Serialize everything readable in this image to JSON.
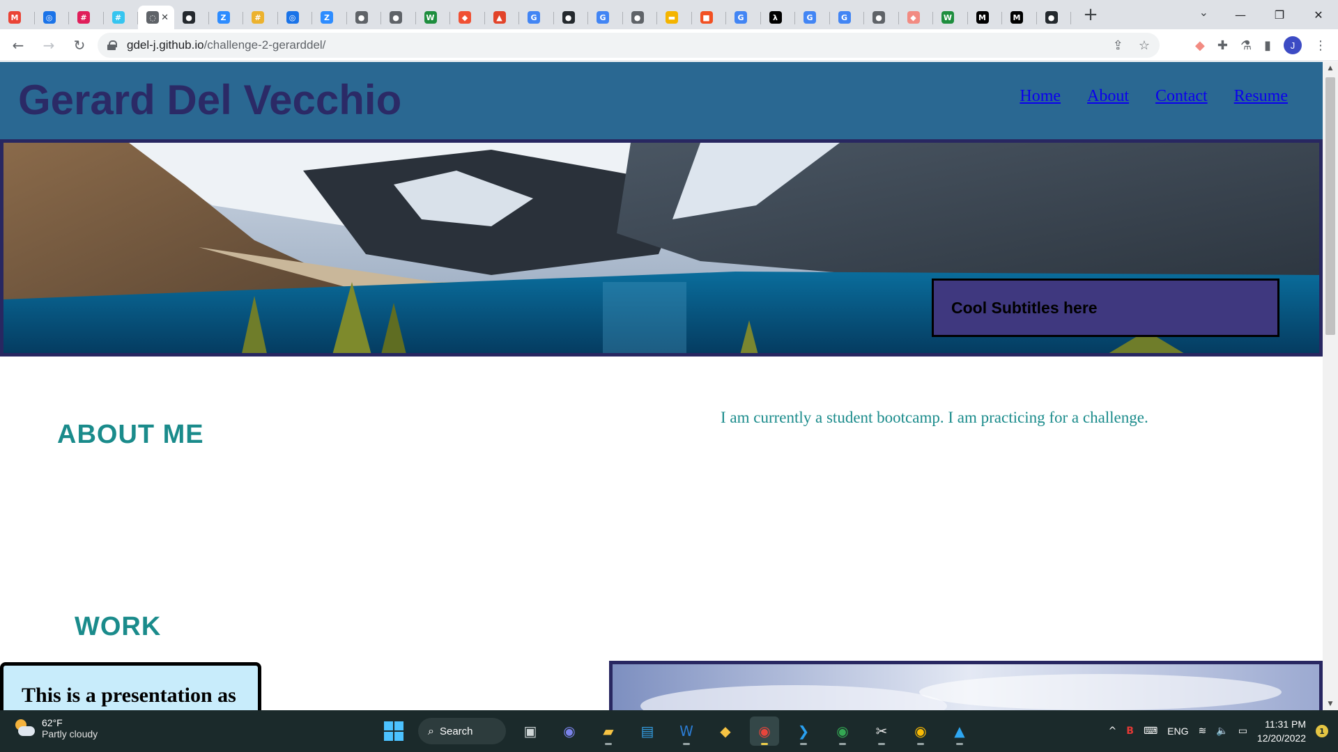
{
  "browser": {
    "tabs": [
      {
        "icon": "gmail-icon",
        "glyph": "M",
        "color": "#ea4335"
      },
      {
        "icon": "chrome-circle-icon",
        "glyph": "◎",
        "color": "#1a73e8"
      },
      {
        "icon": "slack-icon",
        "glyph": "#",
        "color": "#e01e5a"
      },
      {
        "icon": "slack-icon",
        "glyph": "#",
        "color": "#36c5f0"
      },
      {
        "icon": "loading-icon",
        "glyph": "◌",
        "color": "#5f6368",
        "active": true
      },
      {
        "icon": "github-icon",
        "glyph": "●",
        "color": "#24292e"
      },
      {
        "icon": "zoom-icon",
        "glyph": "Z",
        "color": "#2d8cff"
      },
      {
        "icon": "slack-icon",
        "glyph": "#",
        "color": "#ecb22e"
      },
      {
        "icon": "chrome-circle-icon",
        "glyph": "◎",
        "color": "#1a73e8"
      },
      {
        "icon": "zoom-icon",
        "glyph": "Z",
        "color": "#2d8cff"
      },
      {
        "icon": "globe-icon",
        "glyph": "●",
        "color": "#5f6368"
      },
      {
        "icon": "globe-icon",
        "glyph": "●",
        "color": "#5f6368"
      },
      {
        "icon": "w-icon",
        "glyph": "W",
        "color": "#1e8e3e"
      },
      {
        "icon": "git-icon",
        "glyph": "◆",
        "color": "#f05033"
      },
      {
        "icon": "gitlab-icon",
        "glyph": "▲",
        "color": "#e24329"
      },
      {
        "icon": "google-icon",
        "glyph": "G",
        "color": "#4285f4"
      },
      {
        "icon": "github-icon",
        "glyph": "●",
        "color": "#24292e"
      },
      {
        "icon": "google-icon",
        "glyph": "G",
        "color": "#4285f4"
      },
      {
        "icon": "globe-icon",
        "glyph": "●",
        "color": "#5f6368"
      },
      {
        "icon": "slides-icon",
        "glyph": "▬",
        "color": "#f4b400"
      },
      {
        "icon": "microsoft-icon",
        "glyph": "■",
        "color": "#f25022"
      },
      {
        "icon": "google-icon",
        "glyph": "G",
        "color": "#4285f4"
      },
      {
        "icon": "code-icon",
        "glyph": "λ",
        "color": "#000000"
      },
      {
        "icon": "google-icon",
        "glyph": "G",
        "color": "#4285f4"
      },
      {
        "icon": "google-icon",
        "glyph": "G",
        "color": "#4285f4"
      },
      {
        "icon": "globe-icon",
        "glyph": "●",
        "color": "#5f6368"
      },
      {
        "icon": "extension-icon",
        "glyph": "◆",
        "color": "#f28b82"
      },
      {
        "icon": "w-icon",
        "glyph": "W",
        "color": "#1e8e3e"
      },
      {
        "icon": "m-icon",
        "glyph": "M",
        "color": "#000000"
      },
      {
        "icon": "m-icon",
        "glyph": "M",
        "color": "#000000"
      },
      {
        "icon": "github-icon",
        "glyph": "●",
        "color": "#24292e"
      }
    ],
    "url_host": "gdel-j.github.io",
    "url_path": "/challenge-2-gerarddel/",
    "profile_initial": "J"
  },
  "site": {
    "title": "Gerard Del Vecchio",
    "nav": [
      "Home",
      "About",
      "Contact",
      "Resume"
    ],
    "hero_subtitle": "Cool Subtitles here",
    "about_heading": "ABOUT ME",
    "about_text": "I am currently a student bootcamp. I am practicing for a challenge.",
    "work_heading": "WORK",
    "work_card_text": "This is a presentation as"
  },
  "taskbar": {
    "weather_temp": "62°F",
    "weather_desc": "Partly cloudy",
    "search_label": "Search",
    "language": "ENG",
    "time": "11:31 PM",
    "date": "12/20/2022",
    "notification_count": "1"
  },
  "colors": {
    "header_bg": "#2a6892",
    "title": "#2b2a66",
    "teal_heading": "#1a8b8b",
    "subtitle_box": "#3f387f",
    "border_navy": "#282761"
  }
}
